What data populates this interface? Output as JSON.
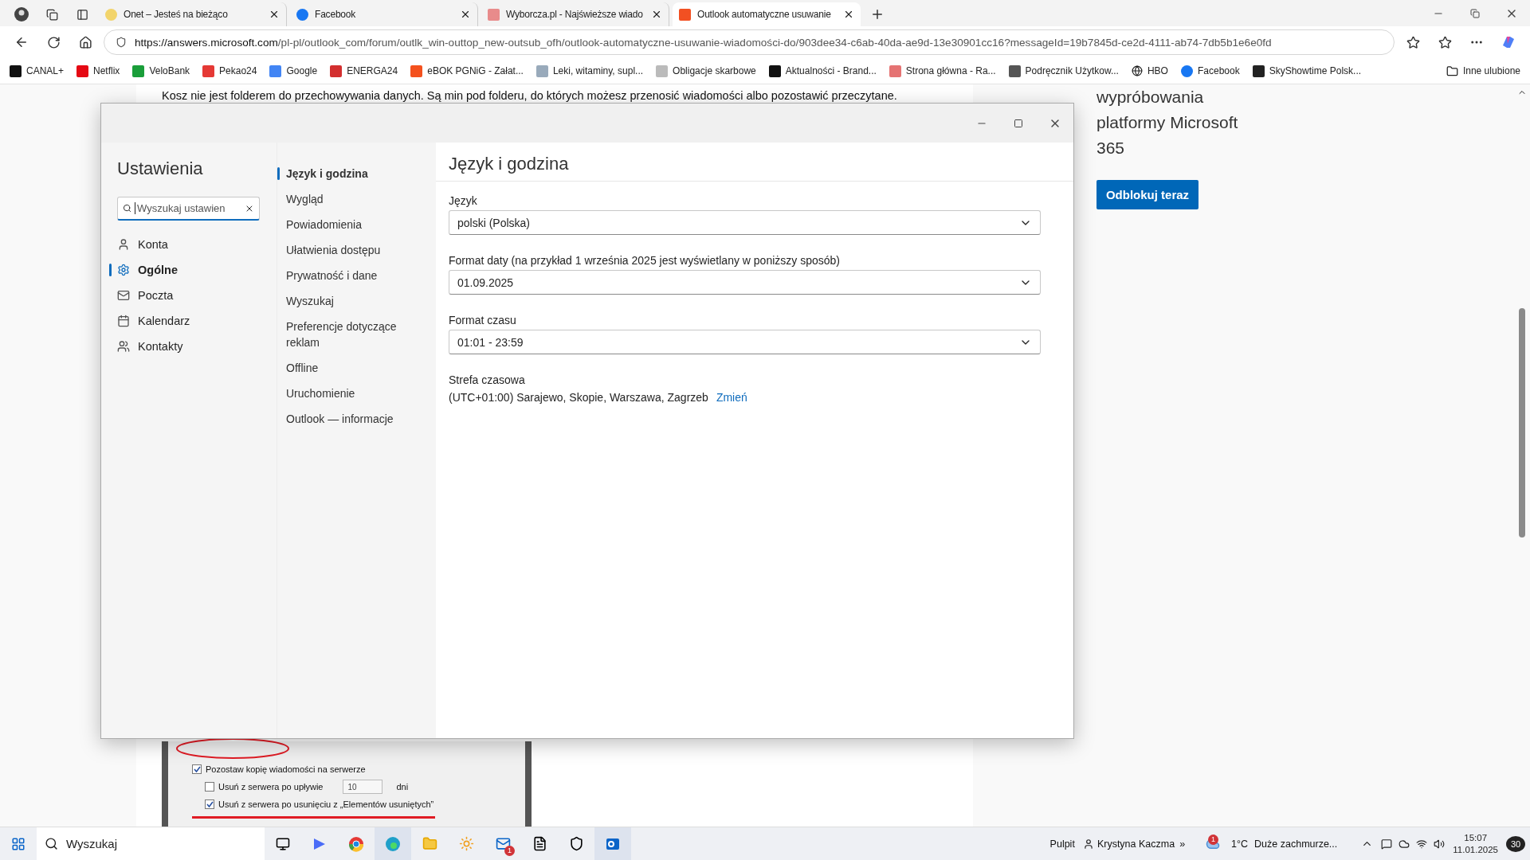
{
  "browser": {
    "tabs": [
      {
        "title": "Onet – Jesteś na bieżąco",
        "selected": false
      },
      {
        "title": "Facebook",
        "selected": false
      },
      {
        "title": "Wyborcza.pl - Najświeższe wiado",
        "selected": false
      },
      {
        "title": "Outlook automatyczne usuwanie",
        "selected": true
      }
    ],
    "url": {
      "host": "https://answers.microsoft.com",
      "path": "/pl-pl/outlook_com/forum/outlk_win-outtop_new-outsub_ofh/outlook-automatyczne-usuwanie-wiadomości-do/903dee34-c6ab-40da-ae9d-13e30901cc16?messageId=19b7845d-ce2d-4111-ab74-7db5b1e6e0fd"
    },
    "bookmarks": [
      {
        "label": "CANAL+"
      },
      {
        "label": "Netflix"
      },
      {
        "label": "VeloBank"
      },
      {
        "label": "Pekao24"
      },
      {
        "label": "Google"
      },
      {
        "label": "ENERGA24"
      },
      {
        "label": "eBOK PGNiG - Załat..."
      },
      {
        "label": "Leki, witaminy, supl..."
      },
      {
        "label": "Obligacje skarbowe"
      },
      {
        "label": "Aktualności - Brand..."
      },
      {
        "label": "Strona główna - Ra..."
      },
      {
        "label": "Podręcznik Użytkow..."
      },
      {
        "label": "HBO"
      },
      {
        "label": "Facebook"
      },
      {
        "label": "SkyShowtime Polsk..."
      }
    ],
    "favorites_folder": "Inne ulubione"
  },
  "page": {
    "article_text": "Kosz nie jest folderem do przechowywania danych. Są min pod folderu, do których możesz przenosić wiadomości albo pozostawić przeczytane.",
    "screenshot_options": [
      {
        "kind": "checkbox",
        "label": "Pozostaw kopię wiadomości na serwerze",
        "checked": true
      },
      {
        "kind": "spin",
        "label": "Usuń z serwera po upływie",
        "checked": false,
        "value": "10",
        "unit": "dni"
      },
      {
        "kind": "checkbox",
        "label": "Usuń z serwera po usunięciu z „Elementów usuniętych”",
        "checked": true
      }
    ],
    "promo_lines": [
      "wypróbowania",
      "platformy Microsoft",
      "365"
    ],
    "promo_button": "Odblokuj teraz"
  },
  "dialog": {
    "title": "Ustawienia",
    "search_placeholder": "Wyszukaj ustawien",
    "nav": [
      {
        "label": "Konta",
        "selected": false
      },
      {
        "label": "Ogólne",
        "selected": true
      },
      {
        "label": "Poczta",
        "selected": false
      },
      {
        "label": "Kalendarz",
        "selected": false
      },
      {
        "label": "Kontakty",
        "selected": false
      }
    ],
    "subnav": [
      {
        "label": "Język i godzina",
        "selected": true
      },
      {
        "label": "Wygląd",
        "selected": false
      },
      {
        "label": "Powiadomienia",
        "selected": false
      },
      {
        "label": "Ułatwienia dostępu",
        "selected": false
      },
      {
        "label": "Prywatność i dane",
        "selected": false
      },
      {
        "label": "Wyszukaj",
        "selected": false
      },
      {
        "label": "Preferencje dotyczące reklam",
        "selected": false
      },
      {
        "label": "Offline",
        "selected": false
      },
      {
        "label": "Uruchomienie",
        "selected": false
      },
      {
        "label": "Outlook — informacje",
        "selected": false
      }
    ],
    "heading": "Język i godzina",
    "fields": [
      {
        "label": "Język",
        "value": "polski (Polska)"
      },
      {
        "label": "Format daty (na przykład 1 września 2025 jest wyświetlany w poniższy sposób)",
        "value": "01.09.2025"
      },
      {
        "label": "Format czasu",
        "value": "01:01 - 23:59"
      }
    ],
    "timezone": {
      "label": "Strefa czasowa",
      "value": "(UTC+01:00) Sarajewo, Skopie, Warszawa, Zagrzeb",
      "link": "Zmień"
    }
  },
  "taskbar": {
    "search_placeholder": "Wyszukaj",
    "app_badge": "1",
    "desktop": "Pulpit",
    "user": "Krystyna Kaczma",
    "more": "»",
    "weather_badge": "1",
    "temperature": "1°C",
    "weather": "Duże zachmurze...",
    "time": "15:07",
    "date": "11.01.2025",
    "notifications": "30"
  }
}
